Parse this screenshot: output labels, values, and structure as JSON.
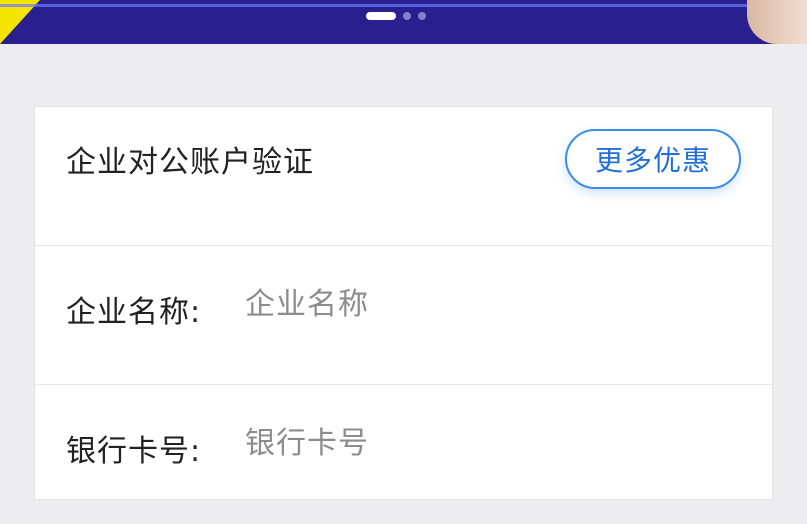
{
  "banner": {
    "carousel_dots": 3,
    "active_index": 0,
    "colors": {
      "background": "#2a1f8e",
      "accent_yellow": "#f5e400"
    }
  },
  "form": {
    "header": {
      "title": "企业对公账户验证",
      "more_button_label": "更多优惠"
    },
    "fields": [
      {
        "label": "企业名称:",
        "value": "",
        "placeholder": "企业名称"
      },
      {
        "label": "银行卡号:",
        "value": "",
        "placeholder": "银行卡号"
      }
    ]
  },
  "colors": {
    "accent": "#3a8ee6",
    "accent_text": "#1f6fd6",
    "text": "#222222",
    "placeholder": "#8c8c8c",
    "page_background": "#ededf0"
  }
}
